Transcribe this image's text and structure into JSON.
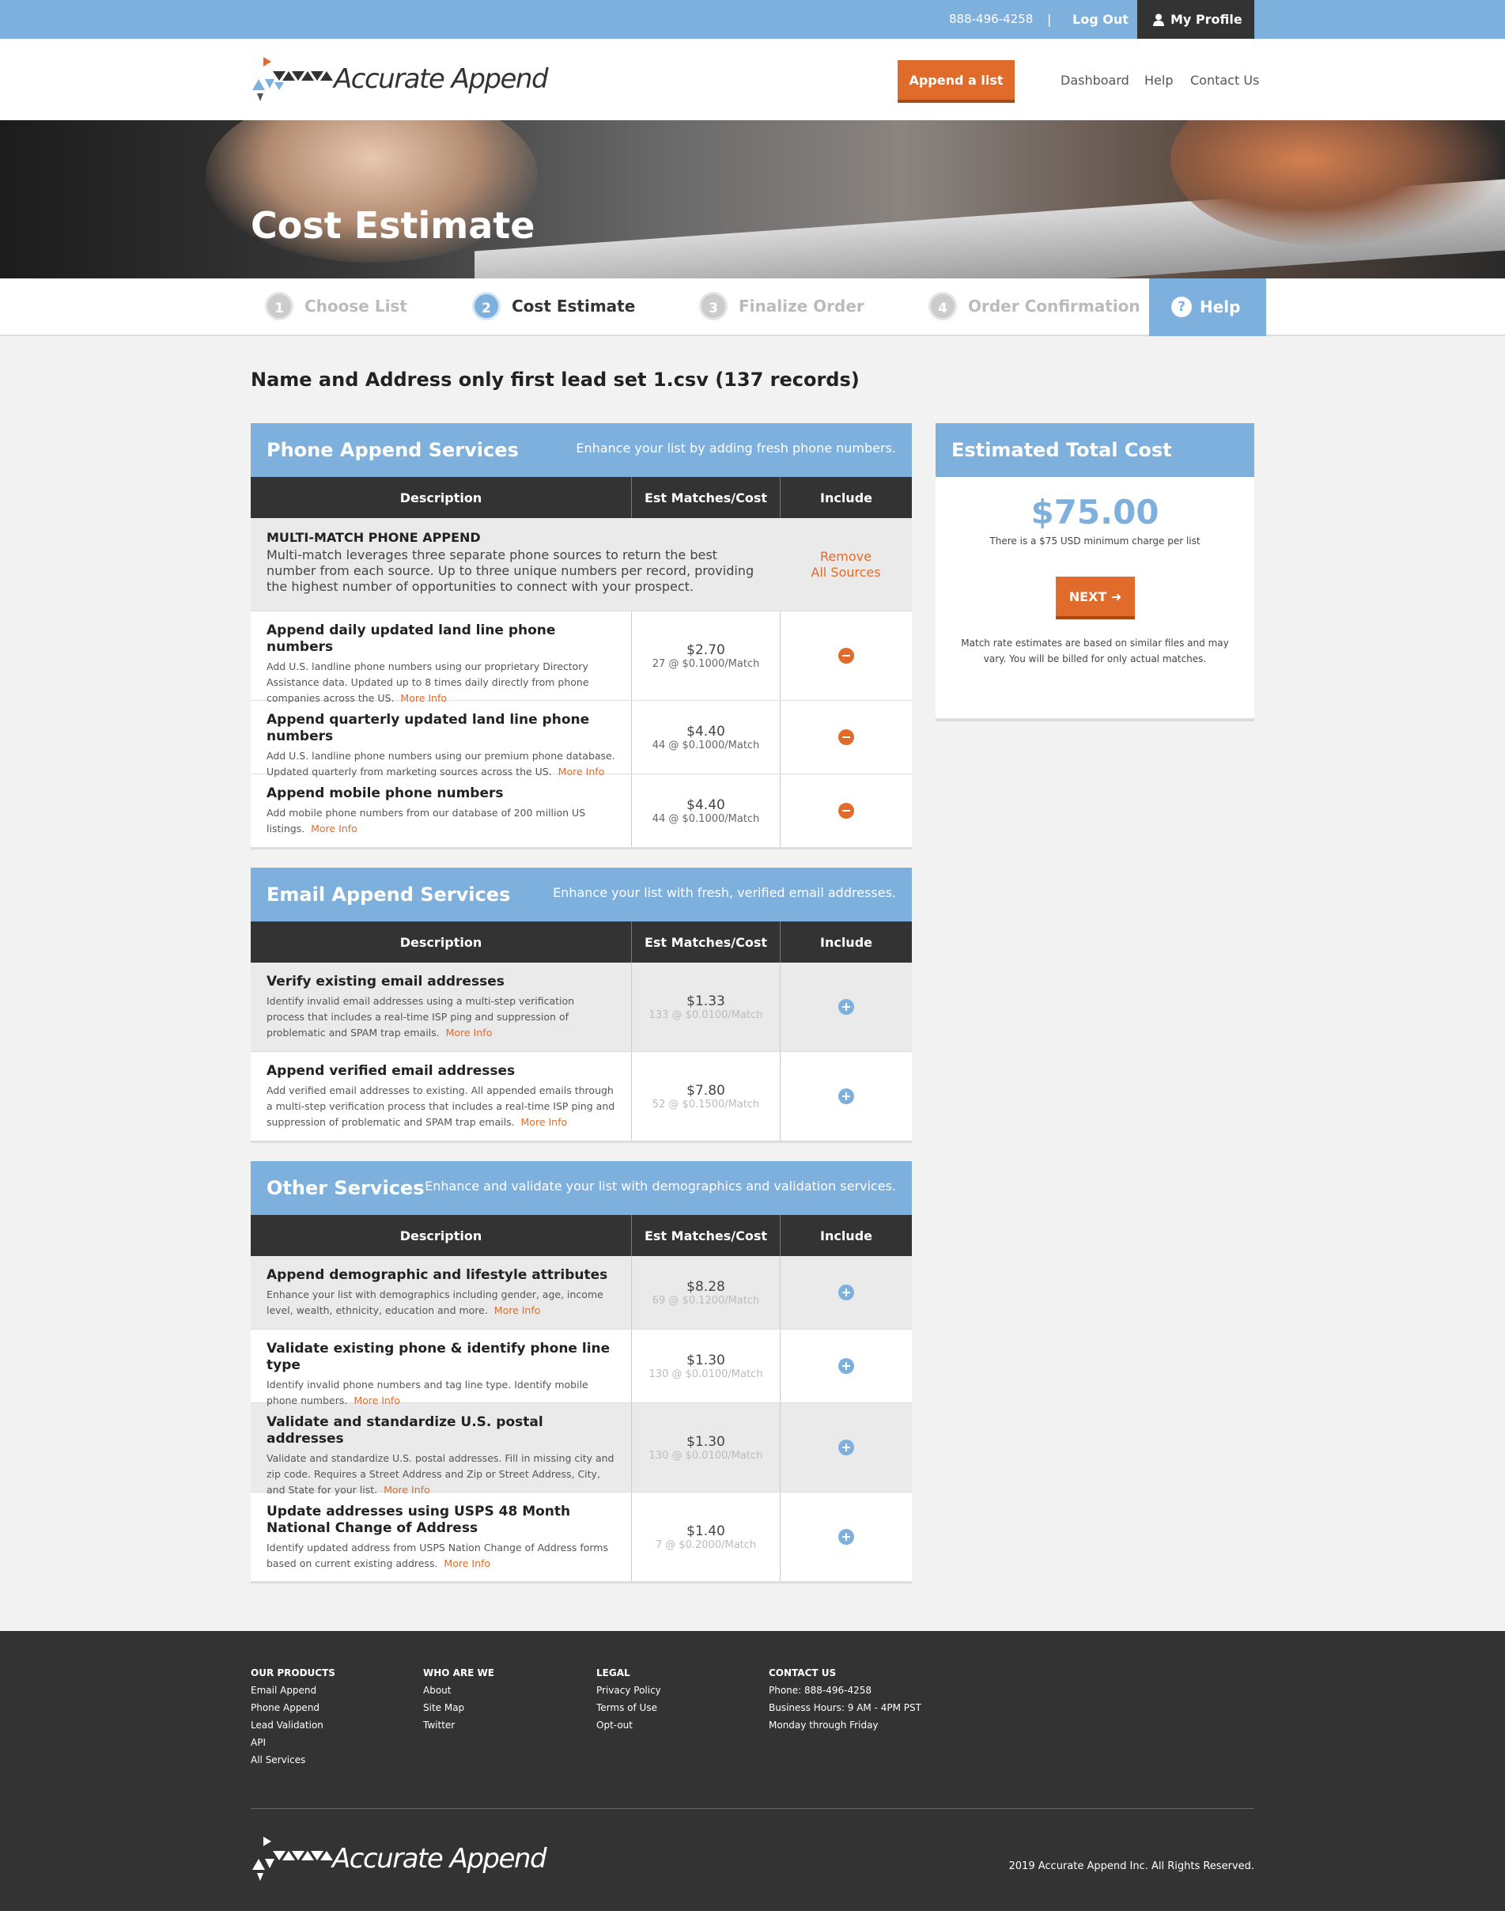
{
  "topbar": {
    "phone": "888-496-4258",
    "separator": "|",
    "logout": "Log Out",
    "profile": "My Profile"
  },
  "header": {
    "logo_text": "Accurate Append",
    "append_button": "Append a list",
    "nav": [
      "Dashboard",
      "Help",
      "Contact Us"
    ]
  },
  "hero": {
    "title": "Cost Estimate"
  },
  "steps": [
    {
      "num": "1",
      "label": "Choose List"
    },
    {
      "num": "2",
      "label": "Cost Estimate"
    },
    {
      "num": "3",
      "label": "Finalize Order"
    },
    {
      "num": "4",
      "label": "Order Confirmation"
    }
  ],
  "help_tab": {
    "icon": "?",
    "label": "Help"
  },
  "file_title": "Name and Address only first lead set 1.csv (137 records)",
  "columns": {
    "description": "Description",
    "matches": "Est Matches/Cost",
    "include": "Include"
  },
  "more_info": "More Info",
  "phone": {
    "title": "Phone Append Services",
    "subtitle": "Enhance your list by adding fresh phone numbers.",
    "multi": {
      "title": "MULTI-MATCH PHONE APPEND",
      "desc": "Multi-match leverages three separate phone sources to return the best number from each source. Up to three unique numbers per record, providing the highest number of opportunities to connect with your prospect.",
      "remove_1": "Remove",
      "remove_2": "All Sources"
    },
    "rows": [
      {
        "title": "Append daily updated land line phone numbers",
        "desc": "Add U.S. landline phone numbers using our proprietary Directory Assistance data. Updated up to 8 times daily directly from phone companies across the US.",
        "price": "$2.70",
        "unit": "27 @ $0.1000/Match"
      },
      {
        "title": "Append quarterly updated land line phone numbers",
        "desc": "Add U.S. landline phone numbers using our premium phone database. Updated quarterly from marketing sources across the US.",
        "price": "$4.40",
        "unit": "44 @ $0.1000/Match"
      },
      {
        "title": "Append mobile phone numbers",
        "desc": "Add mobile phone numbers from our database of 200 million US listings.",
        "price": "$4.40",
        "unit": "44 @ $0.1000/Match"
      }
    ]
  },
  "email": {
    "title": "Email Append Services",
    "subtitle": "Enhance your list with fresh, verified email addresses.",
    "rows": [
      {
        "title": "Verify existing email addresses",
        "desc": "Identify invalid email addresses using a multi-step verification process that includes a real-time ISP ping and suppression of problematic and SPAM trap emails.",
        "price": "$1.33",
        "unit": "133 @ $0.0100/Match"
      },
      {
        "title": "Append verified email addresses",
        "desc": "Add verified email addresses to existing. All appended emails through a multi-step verification process that includes a real-time ISP ping and suppression of problematic and SPAM trap emails.",
        "price": "$7.80",
        "unit": "52 @ $0.1500/Match"
      }
    ]
  },
  "other": {
    "title": "Other Services",
    "subtitle": "Enhance and validate your list with demographics and validation services.",
    "rows": [
      {
        "title": "Append demographic and lifestyle attributes",
        "desc": "Enhance your list with demographics including gender, age, income level, wealth, ethnicity, education and more.",
        "price": "$8.28",
        "unit": "69 @ $0.1200/Match"
      },
      {
        "title": "Validate existing phone & identify phone line type",
        "desc": "Identify invalid phone numbers and tag line type. Identify mobile phone numbers.",
        "price": "$1.30",
        "unit": "130 @ $0.0100/Match"
      },
      {
        "title": "Validate and standardize U.S. postal addresses",
        "desc": "Validate and standardize U.S. postal addresses. Fill in missing city and zip code. Requires a Street Address and Zip or Street Address, City, and State for your list.",
        "price": "$1.30",
        "unit": "130 @ $0.0100/Match"
      },
      {
        "title": "Update addresses using USPS 48 Month National Change of Address",
        "desc": "Identify updated address from USPS Nation Change of Address forms based on current existing address.",
        "price": "$1.40",
        "unit": "7 @ $0.2000/Match"
      }
    ]
  },
  "total": {
    "title": "Estimated Total Cost",
    "amount": "$75.00",
    "min_note": "There is a $75 USD minimum charge per list",
    "next": "NEXT",
    "match_note": "Match rate estimates are based on similar files and may vary. You will be billed for only actual matches."
  },
  "footer": {
    "products": {
      "heading": "OUR PRODUCTS",
      "items": [
        "Email Append",
        "Phone Append",
        "Lead Validation",
        "API",
        "All Services"
      ]
    },
    "who": {
      "heading": "WHO ARE WE",
      "items": [
        "About",
        "Site Map",
        "Twitter"
      ]
    },
    "legal": {
      "heading": "LEGAL",
      "items": [
        "Privacy Policy",
        "Terms of Use",
        "Opt-out"
      ]
    },
    "contact": {
      "heading": "CONTACT US",
      "items": [
        "Phone: 888-496-4258",
        "Business Hours: 9 AM - 4PM PST",
        "Monday through Friday"
      ]
    },
    "logo_text": "Accurate Append",
    "copyright": "2019 Accurate Append Inc. All Rights Reserved."
  },
  "colors": {
    "accent_blue": "#7eb0de",
    "accent_orange": "#e06b2a",
    "dark": "#333333"
  }
}
